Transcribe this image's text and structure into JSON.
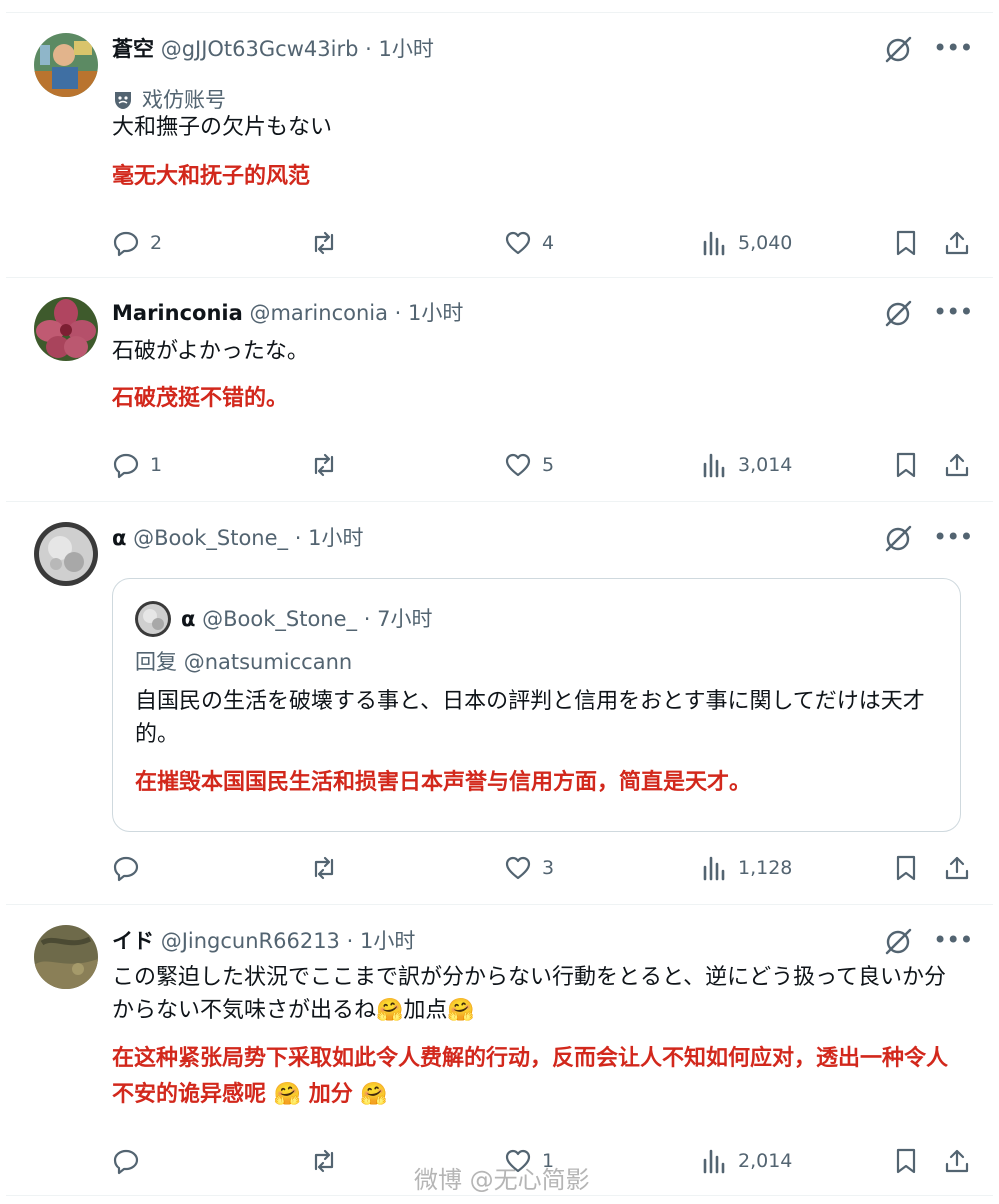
{
  "colors": {
    "translation": "#d2281c",
    "secondary": "#536471",
    "border": "#eff3f4"
  },
  "icons": {
    "reply": "speech-bubble",
    "repost": "two-arrows-loop",
    "like": "heart",
    "views": "bar-chart",
    "bookmark": "bookmark",
    "share": "upload-arrow",
    "grok": "slashed-circle",
    "more": "three-dots"
  },
  "tweets": [
    {
      "name": "蒼空",
      "handle": "@gJJOt63Gcw43irb",
      "dot": "·",
      "time": "1小时",
      "badge": "戏仿账号",
      "text": "大和撫子の欠片もない",
      "translation": "毫无大和抚子的风范",
      "stats": {
        "replies": "2",
        "reposts": "",
        "likes": "4",
        "views": "5,040"
      }
    },
    {
      "name": "Marinconia",
      "handle": "@marinconia",
      "dot": "·",
      "time": "1小时",
      "text": "石破がよかったな。",
      "translation": "石破茂挺不错的。",
      "stats": {
        "replies": "1",
        "reposts": "",
        "likes": "5",
        "views": "3,014"
      }
    },
    {
      "name": "α",
      "handle": "@Book_Stone_",
      "dot": "·",
      "time": "1小时",
      "quote": {
        "name": "α",
        "handle": "@Book_Stone_",
        "dot": "·",
        "time": "7小时",
        "reply_prefix": "回复",
        "reply_to": "@natsumiccann",
        "text": "自国民の生活を破壊する事と、日本の評判と信用をおとす事に関してだけは天才的。",
        "translation": "在摧毁本国国民生活和损害日本声誉与信用方面，简直是天才。"
      },
      "stats": {
        "replies": "",
        "reposts": "",
        "likes": "3",
        "views": "1,128"
      }
    },
    {
      "name": "イド",
      "handle": "@JingcunR66213",
      "dot": "·",
      "time": "1小时",
      "text": "この緊迫した状況でここまで訳が分からない行動をとると、逆にどう扱って良いか分からない不気味さが出るね🤗加点🤗",
      "translation": "在这种紧张局势下采取如此令人费解的行动，反而会让人不知如何应对，透出一种令人不安的诡异感呢 🤗 加分 🤗",
      "stats": {
        "replies": "",
        "reposts": "",
        "likes": "1",
        "views": "2,014"
      }
    }
  ],
  "watermark": "微博 @无心简影"
}
